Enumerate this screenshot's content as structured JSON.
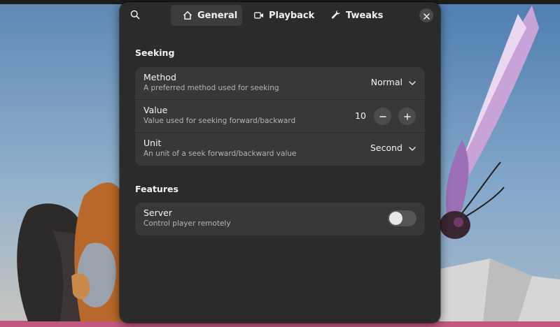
{
  "header": {
    "search_icon": "search-icon",
    "tabs": [
      {
        "label": "General",
        "icon": "home-icon",
        "active": true
      },
      {
        "label": "Playback",
        "icon": "video-camera-icon",
        "active": false
      },
      {
        "label": "Tweaks",
        "icon": "wrench-icon",
        "active": false
      }
    ],
    "close_icon": "close-icon"
  },
  "seeking": {
    "title": "Seeking",
    "method": {
      "title": "Method",
      "subtitle": "A preferred method used for seeking",
      "value": "Normal"
    },
    "value": {
      "title": "Value",
      "subtitle": "Value used for seeking forward/backward",
      "value": "10"
    },
    "unit": {
      "title": "Unit",
      "subtitle": "An unit of a seek forward/backward value",
      "value": "Second"
    }
  },
  "features": {
    "title": "Features",
    "server": {
      "title": "Server",
      "subtitle": "Control player remotely",
      "enabled": false
    }
  },
  "colors": {
    "dialog_bg": "#2b2b2b",
    "row_bg": "#383838",
    "active_tab_bg": "#3d3d3d",
    "toggle_off": "#555555"
  }
}
